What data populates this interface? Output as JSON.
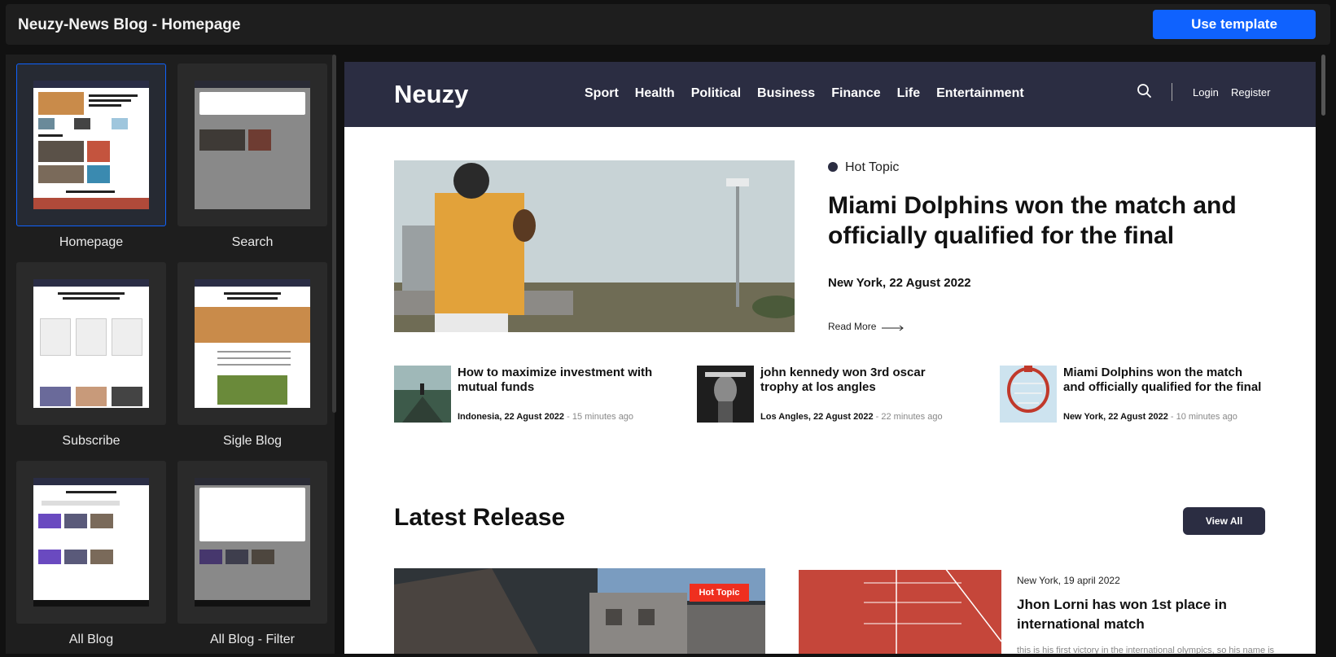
{
  "app": {
    "title": "Neuzy-News Blog - Homepage",
    "use_template_label": "Use template",
    "accent": "#0f62fe"
  },
  "templates": [
    {
      "label": "Homepage",
      "selected": true
    },
    {
      "label": "Search",
      "selected": false
    },
    {
      "label": "Subscribe",
      "selected": false
    },
    {
      "label": "Sigle Blog",
      "selected": false
    },
    {
      "label": "All Blog",
      "selected": false
    },
    {
      "label": "All Blog - Filter",
      "selected": false
    }
  ],
  "site": {
    "logo": "Neuzy",
    "menu": [
      "Sport",
      "Health",
      "Political",
      "Business",
      "Finance",
      "Life",
      "Entertainment"
    ],
    "login": "Login",
    "register": "Register",
    "nav_color": "#2b2d42"
  },
  "hero": {
    "tag": "Hot Topic",
    "title": "Miami Dolphins won the match and officially qualified for the final",
    "location": "New York,",
    "date": "22 Agust 2022",
    "read_more": "Read More"
  },
  "small_posts": [
    {
      "title": "How to maximize investment with mutual funds",
      "location": "Indonesia,",
      "date": "22 Agust 2022",
      "ago": "- 15 minutes ago"
    },
    {
      "title": "john kennedy won 3rd oscar trophy at los angles",
      "location": "Los Angles,",
      "date": "22 Agust 2022",
      "ago": "- 22 minutes ago"
    },
    {
      "title": "Miami Dolphins won the match and officially qualified for the final",
      "location": "New York,",
      "date": "22 Agust 2022",
      "ago": "- 10 minutes ago"
    }
  ],
  "latest": {
    "title": "Latest Release",
    "view_all": "View All",
    "badge": "Hot Topic",
    "badge_color": "#ef2f1f",
    "side_meta": "New York, 19 april 2022",
    "side_title": "Jhon Lorni has won 1st place in international match",
    "side_excerpt": "this is his first victory in the international olympics, so his name is"
  }
}
